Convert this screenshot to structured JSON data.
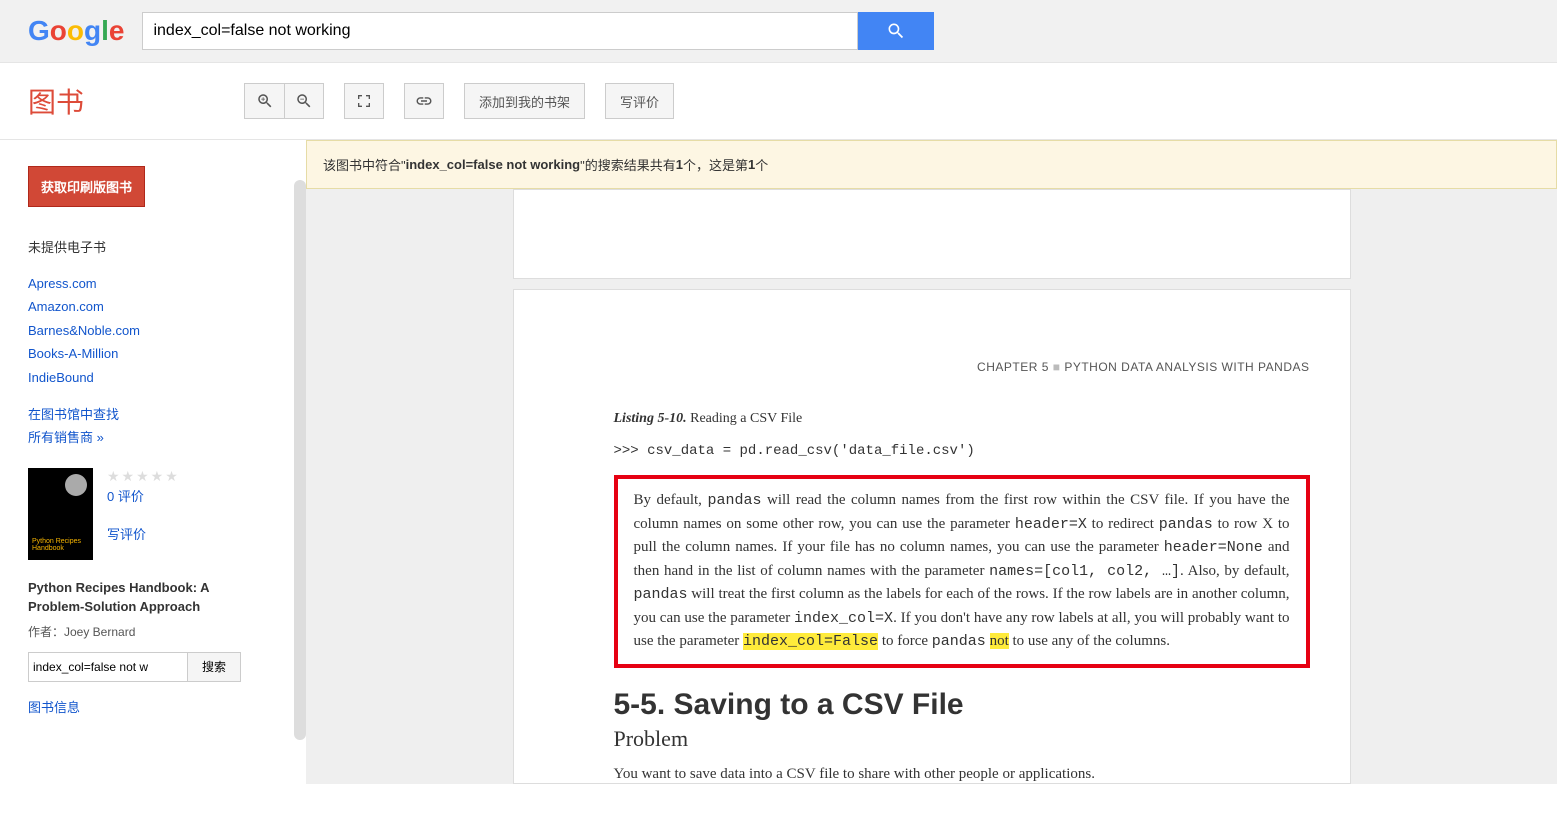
{
  "header": {
    "logo_letters": [
      "G",
      "o",
      "o",
      "g",
      "l",
      "e"
    ],
    "search_value": "index_col=false not working"
  },
  "toolbar": {
    "books_label": "图书",
    "add_shelf": "添加到我的书架",
    "write_review": "写评价"
  },
  "sidebar": {
    "print_btn": "获取印刷版图书",
    "no_ebook": "未提供电子书",
    "stores": [
      "Apress.com",
      "Amazon.com",
      "Barnes&Noble.com",
      "Books-A-Million",
      "IndieBound"
    ],
    "find_library": "在图书馆中查找",
    "all_sellers": "所有销售商 »",
    "reviews_count": "0 评价",
    "write_review": "写评价",
    "book_title": "Python Recipes Handbook: A Problem-Solution Approach",
    "author": "作者：Joey Bernard",
    "inpage_value": "index_col=false not w",
    "inpage_btn": "搜索",
    "book_info": "图书信息",
    "cover_text": "Python Recipes\nHandbook"
  },
  "banner": {
    "prefix": "该图书中符合\"",
    "query": "index_col=false not working",
    "mid": "\"的搜索结果共有 ",
    "count1": "1",
    "mid2": " 个，这是第 ",
    "count2": "1",
    "suffix": " 个"
  },
  "page": {
    "chapter": "CHAPTER 5",
    "chapter_title": "PYTHON DATA ANALYSIS WITH PANDAS",
    "listing_label": "Listing 5-10.",
    "listing_title": "  Reading a CSV File",
    "code": ">>> csv_data = pd.read_csv('data_file.csv')",
    "para_lead": "        By default, ",
    "t1": " will read the column names from the first row within the CSV file. If you have the column names on some other row, you can use the parameter ",
    "t2": " to redirect ",
    "t3": " to row X to pull the column names. If your file has no column names, you can use the parameter ",
    "t4": " and then hand in the list of column names with the parameter ",
    "t5": ". Also, by default, ",
    "t6": " will treat the first column as the labels for each of the rows. If the row labels are in another column, you can use the parameter ",
    "t7": ". If you don't have any row labels at all, you will probably want to use the parameter ",
    "t8": " to force ",
    "t9": " to use any of the columns.",
    "pandas": "pandas",
    "headerX": "header=X",
    "headerNone": "header=None",
    "names": "names=[col1, col2, …]",
    "indexcolX": "index_col=X",
    "indexcolFalse": "index_col=False",
    "not": "not",
    "section": "5-5. Saving to a CSV File",
    "problem": "Problem",
    "para2": "You want to save data into a CSV file to share with other people or applications."
  }
}
